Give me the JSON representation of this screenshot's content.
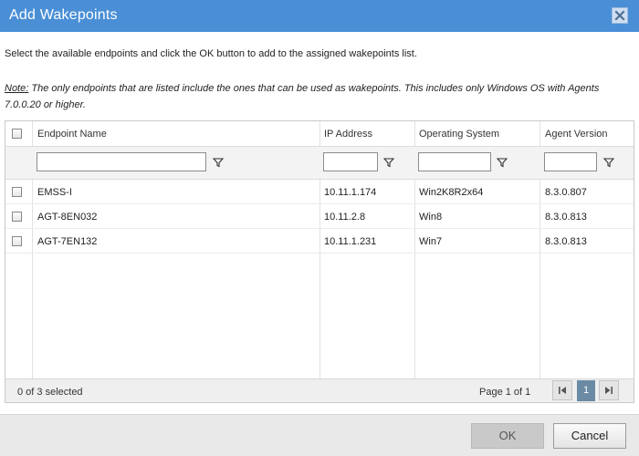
{
  "dialog": {
    "title": "Add Wakepoints",
    "close_icon": "close-x-icon"
  },
  "intro_text": "Select the available endpoints and click the OK button to add to the assigned wakepoints list.",
  "note": {
    "label": "Note:",
    "text": " The only endpoints that are listed include the ones that can be used as wakepoints. This includes only Windows OS with Agents 7.0.0.20 or higher."
  },
  "grid": {
    "columns": [
      "Endpoint Name",
      "IP Address",
      "Operating System",
      "Agent Version"
    ],
    "filter_icon": "funnel-filter-icon",
    "filters": [
      "",
      "",
      "",
      ""
    ],
    "rows": [
      {
        "name": "EMSS-I",
        "ip": "10.11.1.174",
        "os": "Win2K8R2x64",
        "agent": "8.3.0.807"
      },
      {
        "name": "AGT-8EN032",
        "ip": "10.11.2.8",
        "os": "Win8",
        "agent": "8.3.0.813"
      },
      {
        "name": "AGT-7EN132",
        "ip": "10.11.1.231",
        "os": "Win7",
        "agent": "8.3.0.813"
      }
    ],
    "footer": {
      "selected_count": "0 of 3 selected",
      "page_info": "Page 1 of 1",
      "current_page": "1",
      "first_icon": "first-page-icon",
      "last_icon": "last-page-icon"
    }
  },
  "buttons": {
    "ok": "OK",
    "cancel": "Cancel"
  },
  "colors": {
    "titlebar": "#4a8fd6",
    "current_page": "#6b8aa3"
  }
}
